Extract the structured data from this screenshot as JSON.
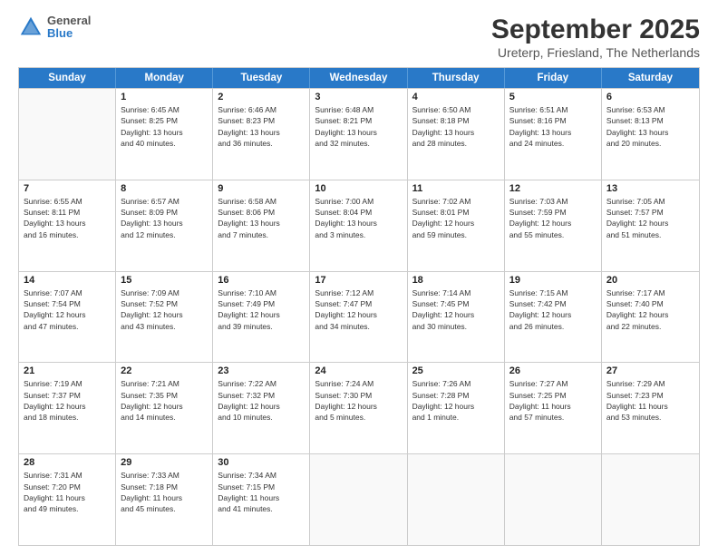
{
  "logo": {
    "general": "General",
    "blue": "Blue"
  },
  "title": "September 2025",
  "subtitle": "Ureterp, Friesland, The Netherlands",
  "days_of_week": [
    "Sunday",
    "Monday",
    "Tuesday",
    "Wednesday",
    "Thursday",
    "Friday",
    "Saturday"
  ],
  "weeks": [
    [
      {
        "day": "",
        "info": ""
      },
      {
        "day": "1",
        "info": "Sunrise: 6:45 AM\nSunset: 8:25 PM\nDaylight: 13 hours\nand 40 minutes."
      },
      {
        "day": "2",
        "info": "Sunrise: 6:46 AM\nSunset: 8:23 PM\nDaylight: 13 hours\nand 36 minutes."
      },
      {
        "day": "3",
        "info": "Sunrise: 6:48 AM\nSunset: 8:21 PM\nDaylight: 13 hours\nand 32 minutes."
      },
      {
        "day": "4",
        "info": "Sunrise: 6:50 AM\nSunset: 8:18 PM\nDaylight: 13 hours\nand 28 minutes."
      },
      {
        "day": "5",
        "info": "Sunrise: 6:51 AM\nSunset: 8:16 PM\nDaylight: 13 hours\nand 24 minutes."
      },
      {
        "day": "6",
        "info": "Sunrise: 6:53 AM\nSunset: 8:13 PM\nDaylight: 13 hours\nand 20 minutes."
      }
    ],
    [
      {
        "day": "7",
        "info": "Sunrise: 6:55 AM\nSunset: 8:11 PM\nDaylight: 13 hours\nand 16 minutes."
      },
      {
        "day": "8",
        "info": "Sunrise: 6:57 AM\nSunset: 8:09 PM\nDaylight: 13 hours\nand 12 minutes."
      },
      {
        "day": "9",
        "info": "Sunrise: 6:58 AM\nSunset: 8:06 PM\nDaylight: 13 hours\nand 7 minutes."
      },
      {
        "day": "10",
        "info": "Sunrise: 7:00 AM\nSunset: 8:04 PM\nDaylight: 13 hours\nand 3 minutes."
      },
      {
        "day": "11",
        "info": "Sunrise: 7:02 AM\nSunset: 8:01 PM\nDaylight: 12 hours\nand 59 minutes."
      },
      {
        "day": "12",
        "info": "Sunrise: 7:03 AM\nSunset: 7:59 PM\nDaylight: 12 hours\nand 55 minutes."
      },
      {
        "day": "13",
        "info": "Sunrise: 7:05 AM\nSunset: 7:57 PM\nDaylight: 12 hours\nand 51 minutes."
      }
    ],
    [
      {
        "day": "14",
        "info": "Sunrise: 7:07 AM\nSunset: 7:54 PM\nDaylight: 12 hours\nand 47 minutes."
      },
      {
        "day": "15",
        "info": "Sunrise: 7:09 AM\nSunset: 7:52 PM\nDaylight: 12 hours\nand 43 minutes."
      },
      {
        "day": "16",
        "info": "Sunrise: 7:10 AM\nSunset: 7:49 PM\nDaylight: 12 hours\nand 39 minutes."
      },
      {
        "day": "17",
        "info": "Sunrise: 7:12 AM\nSunset: 7:47 PM\nDaylight: 12 hours\nand 34 minutes."
      },
      {
        "day": "18",
        "info": "Sunrise: 7:14 AM\nSunset: 7:45 PM\nDaylight: 12 hours\nand 30 minutes."
      },
      {
        "day": "19",
        "info": "Sunrise: 7:15 AM\nSunset: 7:42 PM\nDaylight: 12 hours\nand 26 minutes."
      },
      {
        "day": "20",
        "info": "Sunrise: 7:17 AM\nSunset: 7:40 PM\nDaylight: 12 hours\nand 22 minutes."
      }
    ],
    [
      {
        "day": "21",
        "info": "Sunrise: 7:19 AM\nSunset: 7:37 PM\nDaylight: 12 hours\nand 18 minutes."
      },
      {
        "day": "22",
        "info": "Sunrise: 7:21 AM\nSunset: 7:35 PM\nDaylight: 12 hours\nand 14 minutes."
      },
      {
        "day": "23",
        "info": "Sunrise: 7:22 AM\nSunset: 7:32 PM\nDaylight: 12 hours\nand 10 minutes."
      },
      {
        "day": "24",
        "info": "Sunrise: 7:24 AM\nSunset: 7:30 PM\nDaylight: 12 hours\nand 5 minutes."
      },
      {
        "day": "25",
        "info": "Sunrise: 7:26 AM\nSunset: 7:28 PM\nDaylight: 12 hours\nand 1 minute."
      },
      {
        "day": "26",
        "info": "Sunrise: 7:27 AM\nSunset: 7:25 PM\nDaylight: 11 hours\nand 57 minutes."
      },
      {
        "day": "27",
        "info": "Sunrise: 7:29 AM\nSunset: 7:23 PM\nDaylight: 11 hours\nand 53 minutes."
      }
    ],
    [
      {
        "day": "28",
        "info": "Sunrise: 7:31 AM\nSunset: 7:20 PM\nDaylight: 11 hours\nand 49 minutes."
      },
      {
        "day": "29",
        "info": "Sunrise: 7:33 AM\nSunset: 7:18 PM\nDaylight: 11 hours\nand 45 minutes."
      },
      {
        "day": "30",
        "info": "Sunrise: 7:34 AM\nSunset: 7:15 PM\nDaylight: 11 hours\nand 41 minutes."
      },
      {
        "day": "",
        "info": ""
      },
      {
        "day": "",
        "info": ""
      },
      {
        "day": "",
        "info": ""
      },
      {
        "day": "",
        "info": ""
      }
    ]
  ]
}
